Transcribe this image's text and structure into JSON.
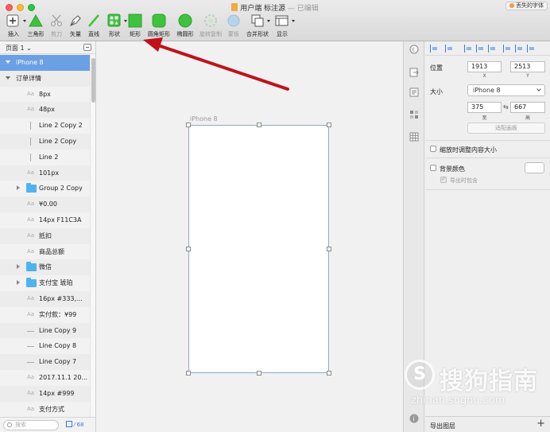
{
  "window": {
    "file_name": "用户端 标注源",
    "status": " — 已编辑",
    "missing_font": "丢失的字体"
  },
  "toolbar": {
    "insert": "插入",
    "triangle": "三角形",
    "scissors": "剪刀",
    "vector": "矢量",
    "line": "直线",
    "shape": "形状",
    "rectangle": "矩形",
    "rounded_rectangle": "圆角矩形",
    "oval": "椭圆形",
    "rotate_copy": "旋转复制",
    "mask": "蒙板",
    "combine_shape": "合并形状",
    "view": "显示"
  },
  "pages": {
    "current": "页面 1"
  },
  "layers": [
    {
      "name": "iPhone 8",
      "type": "artboard",
      "indent": 0,
      "selected": true
    },
    {
      "name": "订单详情",
      "type": "group-open",
      "indent": 0
    },
    {
      "name": "8px",
      "type": "text",
      "indent": 1
    },
    {
      "name": "48px",
      "type": "text",
      "indent": 1
    },
    {
      "name": "Line 2 Copy 2",
      "type": "vline",
      "indent": 1
    },
    {
      "name": "Line 2 Copy",
      "type": "vline",
      "indent": 1
    },
    {
      "name": "Line 2",
      "type": "vline",
      "indent": 1
    },
    {
      "name": "101px",
      "type": "text",
      "indent": 1
    },
    {
      "name": "Group 2 Copy",
      "type": "folder",
      "indent": 1
    },
    {
      "name": "¥0.00",
      "type": "text",
      "indent": 1
    },
    {
      "name": "14px F11C3A",
      "type": "text",
      "indent": 1
    },
    {
      "name": "抵扣",
      "type": "text",
      "indent": 1
    },
    {
      "name": "商品总额",
      "type": "text",
      "indent": 1
    },
    {
      "name": "微信",
      "type": "folder",
      "indent": 1
    },
    {
      "name": "支付宝 琥珀",
      "type": "folder",
      "indent": 1
    },
    {
      "name": "16px #333,...",
      "type": "text",
      "indent": 1
    },
    {
      "name": "实付款：¥99",
      "type": "text",
      "indent": 1
    },
    {
      "name": "Line Copy 9",
      "type": "hline",
      "indent": 1
    },
    {
      "name": "Line Copy 8",
      "type": "hline",
      "indent": 1
    },
    {
      "name": "Line Copy 7",
      "type": "hline",
      "indent": 1
    },
    {
      "name": "2017.11.1 20...",
      "type": "text",
      "indent": 1
    },
    {
      "name": "14px #999",
      "type": "text",
      "indent": 1
    },
    {
      "name": "支付方式",
      "type": "text",
      "indent": 1
    }
  ],
  "layer_icon_text": "Aa",
  "left_footer": {
    "search_placeholder": "搜索",
    "count": "68"
  },
  "canvas": {
    "artboard_label": "iPhone 8"
  },
  "inspector": {
    "position_label": "位置",
    "x_value": "1913",
    "y_value": "2513",
    "x_label": "X",
    "y_label": "Y",
    "size_label": "大小",
    "size_preset": "iPhone 8",
    "width_value": "375",
    "height_value": "667",
    "width_label": "宽",
    "height_label": "高",
    "fit_button": "适配画板",
    "resize_content": "缩放时调整内容大小",
    "background_color": "背景颜色",
    "include_in_export": "导出时包含",
    "export_layer": "导出图层"
  },
  "watermark": {
    "text": "搜狗指南",
    "url": "zhinan.sogou.com"
  }
}
